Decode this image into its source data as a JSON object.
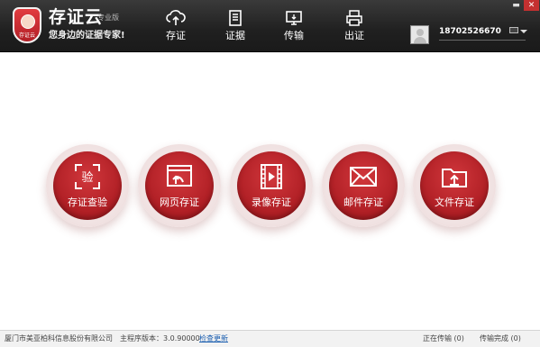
{
  "app": {
    "title": "存证云",
    "edition": "专业版",
    "slogan": "您身边的证据专家!",
    "badge_text": "存证云"
  },
  "nav": {
    "items": [
      {
        "label": "存证",
        "icon": "cloud-upload-icon"
      },
      {
        "label": "证据",
        "icon": "document-icon"
      },
      {
        "label": "传输",
        "icon": "monitor-transfer-icon"
      },
      {
        "label": "出证",
        "icon": "printer-icon"
      }
    ]
  },
  "user": {
    "phone": "18702526670"
  },
  "window": {
    "minimize": "▬",
    "close": "✕"
  },
  "actions": [
    {
      "label": "存证查验",
      "icon": "verify-scan-icon"
    },
    {
      "label": "网页存证",
      "icon": "webpage-icon"
    },
    {
      "label": "录像存证",
      "icon": "video-film-icon"
    },
    {
      "label": "邮件存证",
      "icon": "mail-icon"
    },
    {
      "label": "文件存证",
      "icon": "folder-upload-icon"
    }
  ],
  "status": {
    "company": "厦门市美亚柏科信息股份有限公司",
    "version_label": "主程序版本：3.0.90000",
    "check_update": "检查更新",
    "transferring": "正在传输 (0)",
    "completed": "传输完成 (0)"
  },
  "colors": {
    "topbar": "#202020",
    "accent_red": "#ad1d23",
    "ring": "#f1e3e3",
    "link": "#1c5fb0"
  }
}
